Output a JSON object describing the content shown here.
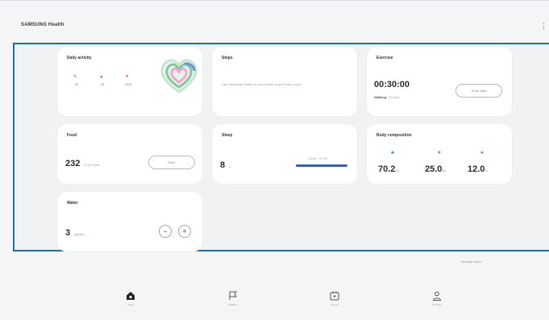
{
  "app": {
    "title": "SAMSUNG Health",
    "more_icon": "more-vertical-icon"
  },
  "cards": {
    "daily_activity": {
      "title": "Daily activity",
      "stats": [
        {
          "icon": "steps-icon",
          "color": "#2e9d5a",
          "value": "00"
        },
        {
          "icon": "active-time-icon",
          "color": "#3a7fd0",
          "value": "00"
        },
        {
          "icon": "calories-icon",
          "color": "#e0503f",
          "value": "0/00"
        }
      ]
    },
    "steps": {
      "title": "Steps",
      "description": "Use Samsung Health on your phone to get a step count."
    },
    "exercise": {
      "title": "Exercise",
      "time": "00:30:00",
      "activity": "Walking",
      "activity_detail": "170 kcal",
      "button": "Enter data"
    },
    "food": {
      "title": "Food",
      "value": "232",
      "unit": "/1,437 kcal",
      "button": "Enter"
    },
    "sleep": {
      "title": "Sleep",
      "value": "8",
      "unit": "h",
      "range": "23:00 - 07:00"
    },
    "body_composition": {
      "title": "Body composition",
      "items": [
        {
          "icon": "body-fat-icon",
          "color": "#2e9d5a",
          "value": "70.2",
          "unit": "kg"
        },
        {
          "icon": "muscle-icon",
          "color": "#3a7fd0",
          "value": "25.0",
          "unit": "kg"
        },
        {
          "icon": "bmi-icon",
          "color": "#e2762d",
          "value": "12.0",
          "unit": "%"
        }
      ]
    },
    "water": {
      "title": "Water",
      "value": "3",
      "unit": "glasses",
      "minus": "−",
      "plus": "+"
    }
  },
  "footer": {
    "manage_items": "Manage items"
  },
  "nav": [
    {
      "label": "Home",
      "icon": "home-icon"
    },
    {
      "label": "Together",
      "icon": "flag-icon"
    },
    {
      "label": "Fitness",
      "icon": "play-calendar-icon"
    },
    {
      "label": "My Page",
      "icon": "person-icon"
    }
  ]
}
